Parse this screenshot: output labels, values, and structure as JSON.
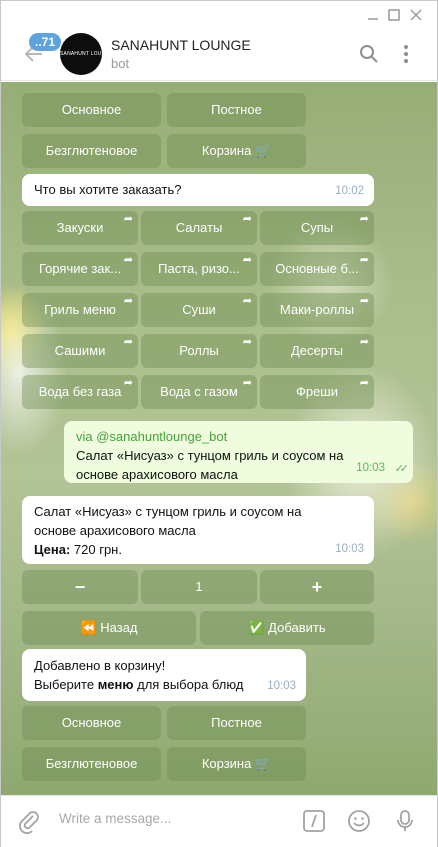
{
  "header": {
    "badge": "..71",
    "avatar_text": "SANAHUNT LOUNGE",
    "title": "SANAHUNT LOUNGE",
    "subtitle": "bot"
  },
  "kb1": [
    "Основное",
    "Постное",
    "Безглютеновое",
    "Корзина 🛒"
  ],
  "msg_order": {
    "text": "Что вы хотите заказать?",
    "time": "10:02"
  },
  "kb2": [
    "Закуски",
    "Салаты",
    "Супы",
    "Горячие зак...",
    "Паста, ризо...",
    "Основные б...",
    "Гриль меню",
    "Суши",
    "Маки-роллы",
    "Сашими",
    "Роллы",
    "Десерты",
    "Вода без газа",
    "Вода с газом",
    "Фреши"
  ],
  "msg_out": {
    "via": "via @sanahuntlounge_bot",
    "line1": "Салат «Нисуаз» с тунцом гриль и соусом на",
    "line2": "основе арахисового масла",
    "time": "10:03"
  },
  "msg_item": {
    "line1": "Салат «Нисуаз» с тунцом гриль и соусом на",
    "line2": "основе арахисового масла",
    "price_label": "Цена:",
    "price_value": " 720 грн.",
    "time": "10:03"
  },
  "stepper": {
    "minus": "−",
    "qty": "1",
    "plus": "+"
  },
  "kb_actions": {
    "back": "⏪ Назад",
    "add": "✅ Добавить"
  },
  "msg_added": {
    "line1": "Добавлено в корзину!",
    "line2_pre": "Выберите ",
    "line2_bold": "меню",
    "line2_post": " для выбора блюд",
    "time": "10:03"
  },
  "kb3": [
    "Основное",
    "Постное",
    "Безглютеновое",
    "Корзина 🛒"
  ],
  "compose": {
    "placeholder": "Write a message..."
  },
  "colors": {
    "accent": "#5fa3de",
    "outgoing_bubble": "#effdde",
    "keyboard_button": "#6e8c50"
  }
}
